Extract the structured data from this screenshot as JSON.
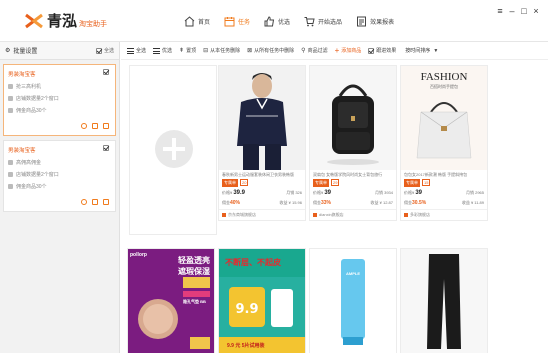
{
  "app": {
    "logo_name": "青泓",
    "logo_sub": "淘宝助手",
    "nav": [
      {
        "label": "首页",
        "active": false,
        "icon": "home-icon"
      },
      {
        "label": "任务",
        "active": true,
        "icon": "calendar-icon"
      },
      {
        "label": "优选",
        "active": false,
        "icon": "thumbs-up-icon"
      },
      {
        "label": "开始选品",
        "active": false,
        "icon": "cart-icon"
      },
      {
        "label": "效果报表",
        "active": false,
        "icon": "report-icon"
      }
    ],
    "window": {
      "minimize": "–",
      "maximize": "□",
      "close": "×"
    }
  },
  "sidebar": {
    "title": "批量设置",
    "select_all": "全选",
    "tasks": [
      {
        "title": "男装淘宝客",
        "line1": "抢三高利机",
        "line2": "店铺数据量2个窗口",
        "line3": "佣金商品30个",
        "selected": true
      },
      {
        "title": "男装淘宝客",
        "line1": "高佣高佣金",
        "line2": "店铺数据量2个窗口",
        "line3": "佣金商品30个",
        "selected": false
      }
    ]
  },
  "toolbar": {
    "items": [
      {
        "label": "全选",
        "icon": "select-all-icon"
      },
      {
        "label": "优选",
        "icon": "list-icon"
      },
      {
        "label": "置顶",
        "icon": "pin-top-icon"
      },
      {
        "label": "从本任务删除",
        "icon": "remove-task-icon"
      },
      {
        "label": "从所有任务中删除",
        "icon": "remove-all-icon"
      },
      {
        "label": "商品过滤",
        "icon": "filter-icon"
      },
      {
        "label": "添加商品",
        "icon": "plus-icon"
      },
      {
        "label": "跟进效果",
        "icon": "checkbox-icon"
      }
    ],
    "sort_label": "按时间排序"
  },
  "products": [
    {
      "title": "春秋新男士运动服套装休闲卫衣男装韩版",
      "tag_a": "专属单",
      "tag_b": "20",
      "price": "39.9",
      "sales": "月销 326",
      "commission_pct": "40%",
      "commission_label": "佣金",
      "earn": "收益 ¥ 15.96",
      "shop": "京东商城旗舰店"
    },
    {
      "title": "双肩包 女韩版学院风时尚女士背包旅行",
      "tag_a": "专属单",
      "tag_b": "29",
      "price": "39",
      "sales": "月销 3934",
      "commission_pct": "33%",
      "commission_label": "佣金",
      "earn": "收益 ¥ 12.87",
      "shop": "dianxin旗舰店"
    },
    {
      "title": "包包女2017新款潮 韩版 手提斜挎包",
      "tag_a": "专属单",
      "tag_b": "15",
      "price": "39",
      "sales": "月销 2965",
      "commission_pct": "30.5%",
      "commission_label": "佣金",
      "earn": "收益 ¥ 11.89",
      "shop": "多彩旗舰店"
    }
  ],
  "row2": [
    {
      "brand": "pollorp",
      "headline1": "轻盈透亮",
      "headline2": "遮瑕保湿",
      "sub": "隐孔气垫 BB"
    },
    {
      "headline1": "不断层、不起皮",
      "sub": "9.9 元 5片试用装"
    },
    {
      "brand": "AMPLE"
    },
    {}
  ],
  "colors": {
    "accent": "#e8601c",
    "nav_active": "#f07b1d"
  }
}
